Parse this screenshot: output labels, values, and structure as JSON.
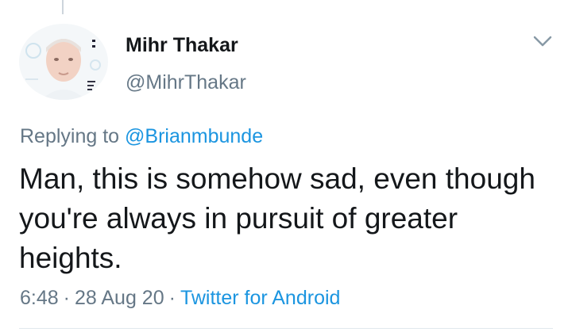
{
  "tweet": {
    "author": {
      "display_name": "Mihr Thakar",
      "handle": "@MihrThakar",
      "avatar_icon": "profile-photo"
    },
    "replying_to_prefix": "Replying to",
    "replying_to_handle": "@Brianmbunde",
    "text": "Man, this is somehow sad, even though you're always in pursuit of greater heights.",
    "time": "6:48",
    "date": "28 Aug 20",
    "source": "Twitter for Android",
    "separator": "·",
    "menu_icon": "chevron-down-icon"
  },
  "colors": {
    "text_primary": "#14171a",
    "text_secondary": "#657786",
    "link": "#1b95e0",
    "divider": "#e1e8ed"
  }
}
